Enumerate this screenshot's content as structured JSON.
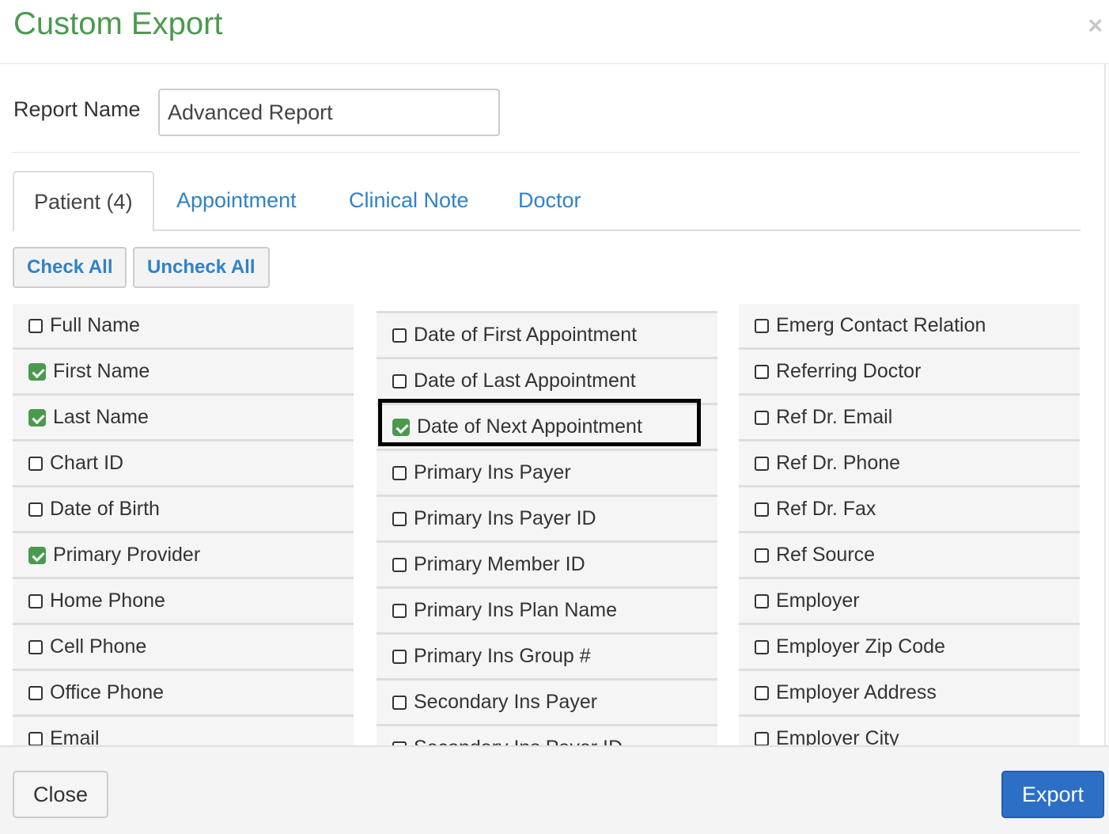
{
  "dialog": {
    "title": "Custom Export",
    "close_icon": "×"
  },
  "report_name": {
    "label": "Report Name",
    "value": "Advanced Report"
  },
  "tabs": [
    {
      "label": "Patient (4)",
      "active": true
    },
    {
      "label": "Appointment"
    },
    {
      "label": "Clinical Note"
    },
    {
      "label": "Doctor"
    }
  ],
  "actions": {
    "check_all": "Check All",
    "uncheck_all": "Uncheck All"
  },
  "columns": [
    [
      {
        "label": "Full Name",
        "checked": false
      },
      {
        "label": "First Name",
        "checked": true
      },
      {
        "label": "Last Name",
        "checked": true
      },
      {
        "label": "Chart ID",
        "checked": false
      },
      {
        "label": "Date of Birth",
        "checked": false
      },
      {
        "label": "Primary Provider",
        "checked": true
      },
      {
        "label": "Home Phone",
        "checked": false
      },
      {
        "label": "Cell Phone",
        "checked": false
      },
      {
        "label": "Office Phone",
        "checked": false
      },
      {
        "label": "Email",
        "checked": false
      }
    ],
    [
      {
        "label": "Date of First Appointment",
        "checked": false
      },
      {
        "label": "Date of Last Appointment",
        "checked": false
      },
      {
        "label": "Date of Next Appointment",
        "checked": true,
        "highlighted": true
      },
      {
        "label": "Primary Ins Payer",
        "checked": false
      },
      {
        "label": "Primary Ins Payer ID",
        "checked": false
      },
      {
        "label": "Primary Member ID",
        "checked": false
      },
      {
        "label": "Primary Ins Plan Name",
        "checked": false
      },
      {
        "label": "Primary Ins Group #",
        "checked": false
      },
      {
        "label": "Secondary Ins Payer",
        "checked": false
      },
      {
        "label": "Secondary Ins Payer ID",
        "checked": false
      }
    ],
    [
      {
        "label": "Emerg Contact Relation",
        "checked": false
      },
      {
        "label": "Referring Doctor",
        "checked": false
      },
      {
        "label": "Ref Dr. Email",
        "checked": false
      },
      {
        "label": "Ref Dr. Phone",
        "checked": false
      },
      {
        "label": "Ref Dr. Fax",
        "checked": false
      },
      {
        "label": "Ref Source",
        "checked": false
      },
      {
        "label": "Employer",
        "checked": false
      },
      {
        "label": "Employer Zip Code",
        "checked": false
      },
      {
        "label": "Employer Address",
        "checked": false
      },
      {
        "label": "Employer City",
        "checked": false
      }
    ]
  ],
  "footer": {
    "close": "Close",
    "export": "Export"
  },
  "colors": {
    "title": "#4a9a4e",
    "link": "#2f82c7",
    "checked": "#4a9a4e",
    "primary": "#2d6fc5"
  }
}
